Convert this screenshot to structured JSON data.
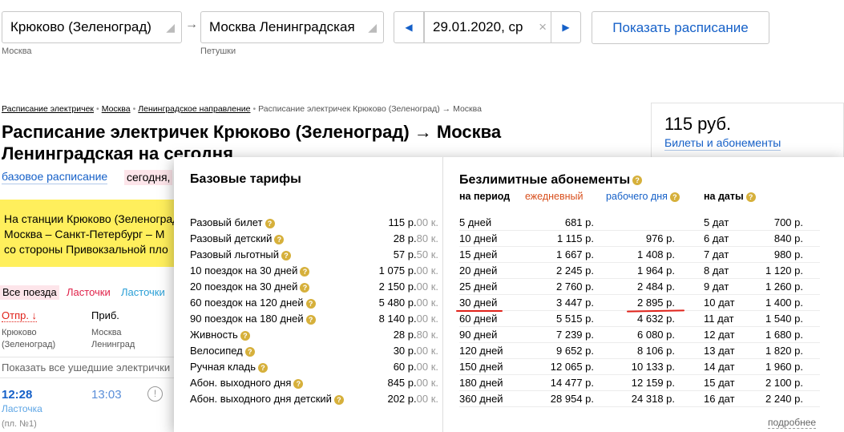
{
  "search": {
    "from": "Крюково (Зеленоград)",
    "from_sub": "Москва",
    "to": "Москва Ленинградская",
    "to_sub": "Петушки",
    "arrow": "→",
    "prev": "◀",
    "date": "29.01.2020, ср",
    "clear": "×",
    "next": "▶",
    "show_button": "Показать расписание"
  },
  "breadcrumbs": [
    "Расписание электричек",
    "Москва",
    "Ленинградское направление",
    "Расписание электричек Крюково (Зеленоград) → Москва"
  ],
  "breadcrumb_sep": "•",
  "title": "Расписание электричек Крюково (Зеленоград) → Москва Ленинградская на сегодня",
  "price": {
    "value": "115 руб.",
    "link": "Билеты и абонементы"
  },
  "view_tabs": {
    "base": "базовое расписание",
    "today": "сегодня,"
  },
  "notice": [
    "На станции Крюково (Зеленоград)",
    "Москва – Санкт-Петербург – М",
    "со стороны Привокзальной пло"
  ],
  "filters": {
    "all": "Все поезда",
    "lastochki1": "Ласточки",
    "lastochki2": "Ласточки"
  },
  "columns": {
    "dep": "Отпр. ↓",
    "arr": "Приб.",
    "dep_station": [
      "Крюково",
      "(Зеленоград)"
    ],
    "arr_station": [
      "Москва",
      "Ленинград"
    ]
  },
  "show_departed": "Показать все ушедшие электрички",
  "train": {
    "dep": "12:28",
    "arr": "13:03",
    "info": "!",
    "type": "Ласточка",
    "platform": "(пл. №1)"
  },
  "tariffs": {
    "base_title": "Базовые тарифы",
    "base_rows": [
      {
        "name": "Разовый билет",
        "rub": "115 р.",
        "kop": "00 к."
      },
      {
        "name": "Разовый детский",
        "rub": "28 р.",
        "kop": "80 к."
      },
      {
        "name": "Разовый льготный",
        "rub": "57 р.",
        "kop": "50 к."
      },
      {
        "name": "10 поездок на 30 дней",
        "rub": "1 075 р.",
        "kop": "00 к."
      },
      {
        "name": "20 поездок на 30 дней",
        "rub": "2 150 р.",
        "kop": "00 к."
      },
      {
        "name": "60 поездок на 120 дней",
        "rub": "5 480 р.",
        "kop": "00 к."
      },
      {
        "name": "90 поездок на 180 дней",
        "rub": "8 140 р.",
        "kop": "00 к."
      },
      {
        "name": "Живность",
        "rub": "28 р.",
        "kop": "80 к."
      },
      {
        "name": "Велосипед",
        "rub": "30 р.",
        "kop": "00 к."
      },
      {
        "name": "Ручная кладь",
        "rub": "60 р.",
        "kop": "00 к."
      },
      {
        "name": "Абон. выходного дня",
        "rub": "845 р.",
        "kop": "00 к."
      },
      {
        "name": "Абон. выходного дня детский",
        "rub": "202 р.",
        "kop": "00 к."
      }
    ],
    "unlim_title": "Безлимитные абонементы",
    "unlim_headers": {
      "period": "на период",
      "daily": "ежедневный",
      "workdays": "рабочего дня",
      "dates": "на даты"
    },
    "unlim_rows": [
      {
        "period": "5 дней",
        "daily": "681 р.",
        "work": "",
        "dates": "5 дат",
        "dprice": "700 р."
      },
      {
        "period": "10 дней",
        "daily": "1 115 р.",
        "work": "976 р.",
        "dates": "6 дат",
        "dprice": "840 р."
      },
      {
        "period": "15 дней",
        "daily": "1 667 р.",
        "work": "1 408 р.",
        "dates": "7 дат",
        "dprice": "980 р."
      },
      {
        "period": "20 дней",
        "daily": "2 245 р.",
        "work": "1 964 р.",
        "dates": "8 дат",
        "dprice": "1 120 р."
      },
      {
        "period": "25 дней",
        "daily": "2 760 р.",
        "work": "2 484 р.",
        "dates": "9 дат",
        "dprice": "1 260 р."
      },
      {
        "period": "30 дней",
        "daily": "3 447 р.",
        "work": "2 895 р.",
        "dates": "10 дат",
        "dprice": "1 400 р."
      },
      {
        "period": "60 дней",
        "daily": "5 515 р.",
        "work": "4 632 р.",
        "dates": "11 дат",
        "dprice": "1 540 р."
      },
      {
        "period": "90 дней",
        "daily": "7 239 р.",
        "work": "6 080 р.",
        "dates": "12 дат",
        "dprice": "1 680 р."
      },
      {
        "period": "120 дней",
        "daily": "9 652 р.",
        "work": "8 106 р.",
        "dates": "13 дат",
        "dprice": "1 820 р."
      },
      {
        "period": "150 дней",
        "daily": "12 065 р.",
        "work": "10 133 р.",
        "dates": "14 дат",
        "dprice": "1 960 р."
      },
      {
        "period": "180 дней",
        "daily": "14 477 р.",
        "work": "12 159 р.",
        "dates": "15 дат",
        "dprice": "2 100 р."
      },
      {
        "period": "360 дней",
        "daily": "28 954 р.",
        "work": "24 318 р.",
        "dates": "16 дат",
        "dprice": "2 240 р."
      }
    ],
    "more": "подробнее"
  },
  "colors": {
    "link": "#1560c8",
    "accent_red": "#e0221a",
    "notice_bg": "#ffef5c",
    "help_icon": "#d6b03b"
  }
}
